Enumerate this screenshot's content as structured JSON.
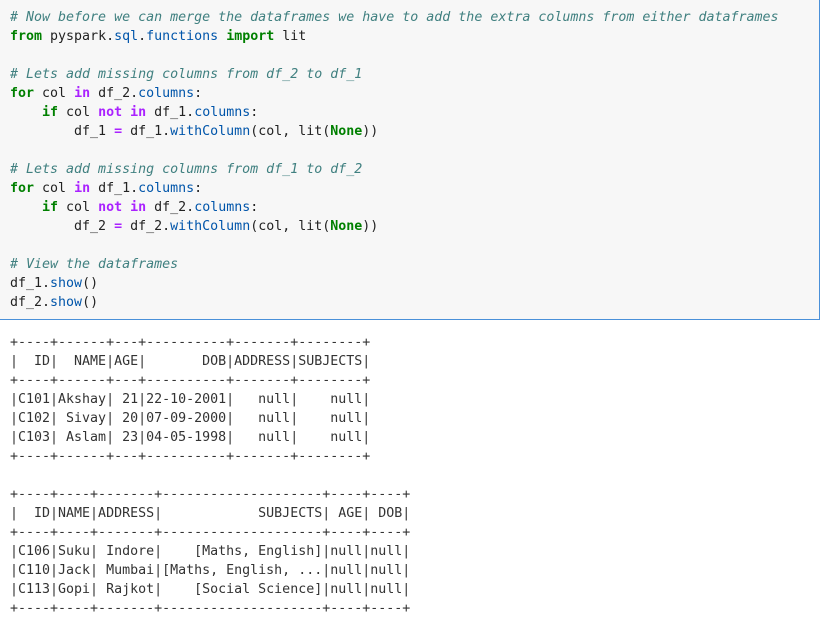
{
  "code_cell": {
    "lines": [
      [
        {
          "t": "cm",
          "v": "# Now before we can merge the dataframes we have to add the extra columns from either dataframes"
        }
      ],
      [
        {
          "t": "kw",
          "v": "from"
        },
        {
          "t": "nm",
          "v": " pyspark"
        },
        {
          "t": "nm",
          "v": "."
        },
        {
          "t": "attr",
          "v": "sql"
        },
        {
          "t": "nm",
          "v": "."
        },
        {
          "t": "attr",
          "v": "functions"
        },
        {
          "t": "nm",
          "v": " "
        },
        {
          "t": "kw",
          "v": "import"
        },
        {
          "t": "nm",
          "v": " lit"
        }
      ],
      [],
      [
        {
          "t": "cm",
          "v": "# Lets add missing columns from df_2 to df_1"
        }
      ],
      [
        {
          "t": "kw",
          "v": "for"
        },
        {
          "t": "nm",
          "v": " col "
        },
        {
          "t": "kwp",
          "v": "in"
        },
        {
          "t": "nm",
          "v": " df_2."
        },
        {
          "t": "attr",
          "v": "columns"
        },
        {
          "t": "nm",
          "v": ":"
        }
      ],
      [
        {
          "t": "nm",
          "v": "    "
        },
        {
          "t": "kw",
          "v": "if"
        },
        {
          "t": "nm",
          "v": " col "
        },
        {
          "t": "kwp",
          "v": "not"
        },
        {
          "t": "nm",
          "v": " "
        },
        {
          "t": "kwp",
          "v": "in"
        },
        {
          "t": "nm",
          "v": " df_1."
        },
        {
          "t": "attr",
          "v": "columns"
        },
        {
          "t": "nm",
          "v": ":"
        }
      ],
      [
        {
          "t": "nm",
          "v": "        df_1 "
        },
        {
          "t": "op",
          "v": "="
        },
        {
          "t": "nm",
          "v": " df_1."
        },
        {
          "t": "attr",
          "v": "withColumn"
        },
        {
          "t": "nm",
          "v": "(col, lit("
        },
        {
          "t": "nb",
          "v": "None"
        },
        {
          "t": "nm",
          "v": "))"
        }
      ],
      [],
      [
        {
          "t": "cm",
          "v": "# Lets add missing columns from df_1 to df_2"
        }
      ],
      [
        {
          "t": "kw",
          "v": "for"
        },
        {
          "t": "nm",
          "v": " col "
        },
        {
          "t": "kwp",
          "v": "in"
        },
        {
          "t": "nm",
          "v": " df_1."
        },
        {
          "t": "attr",
          "v": "columns"
        },
        {
          "t": "nm",
          "v": ":"
        }
      ],
      [
        {
          "t": "nm",
          "v": "    "
        },
        {
          "t": "kw",
          "v": "if"
        },
        {
          "t": "nm",
          "v": " col "
        },
        {
          "t": "kwp",
          "v": "not"
        },
        {
          "t": "nm",
          "v": " "
        },
        {
          "t": "kwp",
          "v": "in"
        },
        {
          "t": "nm",
          "v": " df_2."
        },
        {
          "t": "attr",
          "v": "columns"
        },
        {
          "t": "nm",
          "v": ":"
        }
      ],
      [
        {
          "t": "nm",
          "v": "        df_2 "
        },
        {
          "t": "op",
          "v": "="
        },
        {
          "t": "nm",
          "v": " df_2."
        },
        {
          "t": "attr",
          "v": "withColumn"
        },
        {
          "t": "nm",
          "v": "(col, lit("
        },
        {
          "t": "nb",
          "v": "None"
        },
        {
          "t": "nm",
          "v": "))"
        }
      ],
      [],
      [
        {
          "t": "cm",
          "v": "# View the dataframes"
        }
      ],
      [
        {
          "t": "nm",
          "v": "df_1."
        },
        {
          "t": "attr",
          "v": "show"
        },
        {
          "t": "nm",
          "v": "()"
        }
      ],
      [
        {
          "t": "nm",
          "v": "df_2."
        },
        {
          "t": "attr",
          "v": "show"
        },
        {
          "t": "nm",
          "v": "()"
        }
      ]
    ]
  },
  "outputs": {
    "df_1": "+----+------+---+----------+-------+--------+\n|  ID|  NAME|AGE|       DOB|ADDRESS|SUBJECTS|\n+----+------+---+----------+-------+--------+\n|C101|Akshay| 21|22-10-2001|   null|    null|\n|C102| Sivay| 20|07-09-2000|   null|    null|\n|C103| Aslam| 23|04-05-1998|   null|    null|\n+----+------+---+----------+-------+--------+",
    "df_2": "+----+----+-------+--------------------+----+----+\n|  ID|NAME|ADDRESS|            SUBJECTS| AGE| DOB|\n+----+----+-------+--------------------+----+----+\n|C106|Suku| Indore|    [Maths, English]|null|null|\n|C110|Jack| Mumbai|[Maths, English, ...|null|null|\n|C113|Gopi| Rajkot|    [Social Science]|null|null|\n+----+----+-------+--------------------+----+----+"
  }
}
